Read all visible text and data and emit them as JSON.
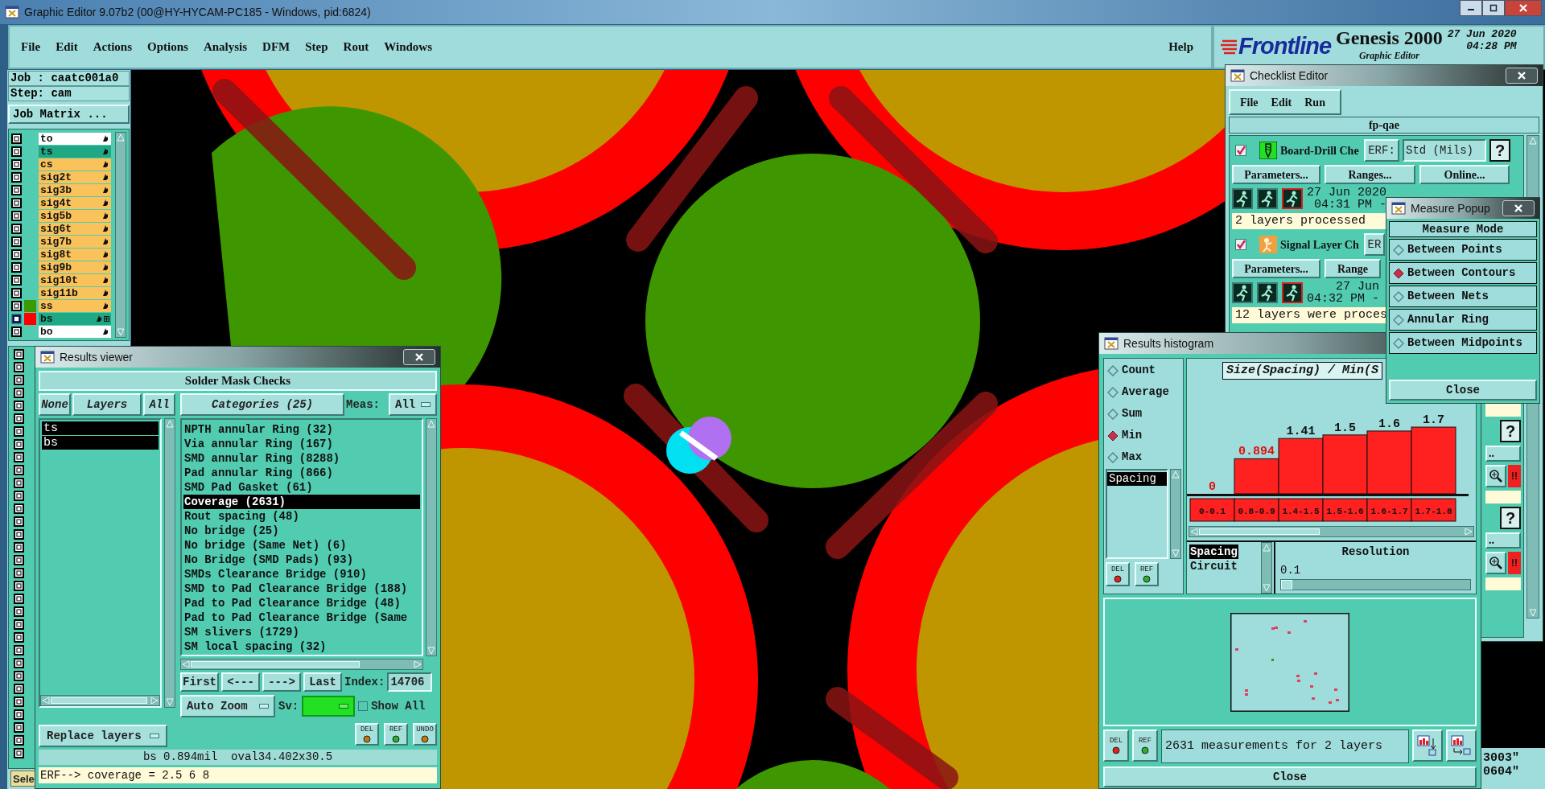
{
  "window": {
    "title": "Graphic Editor 9.07b2 (00@HY-HYCAM-PC185 - Windows, pid:6824)"
  },
  "menu": [
    "File",
    "Edit",
    "Actions",
    "Options",
    "Analysis",
    "DFM",
    "Step",
    "Rout",
    "Windows"
  ],
  "help": "Help",
  "branding": {
    "logo": "Frontline",
    "product": "Genesis 2000",
    "subtitle": "Graphic Editor",
    "date": "27 Jun 2020",
    "time": "04:28 PM"
  },
  "job": {
    "job": "Job : caatc001a0",
    "step": "Step: cam",
    "matrix_button": "Job Matrix ..."
  },
  "layers": [
    {
      "name": "to",
      "kind": "misc",
      "selected": false
    },
    {
      "name": "ts",
      "kind": "mask",
      "selected": false
    },
    {
      "name": "cs",
      "kind": "board",
      "selected": false
    },
    {
      "name": "sig2t",
      "kind": "board",
      "selected": false
    },
    {
      "name": "sig3b",
      "kind": "board",
      "selected": false
    },
    {
      "name": "sig4t",
      "kind": "board",
      "selected": false
    },
    {
      "name": "sig5b",
      "kind": "board",
      "selected": false
    },
    {
      "name": "sig6t",
      "kind": "board",
      "selected": false
    },
    {
      "name": "sig7b",
      "kind": "board",
      "selected": false
    },
    {
      "name": "sig8t",
      "kind": "board",
      "selected": false
    },
    {
      "name": "sig9b",
      "kind": "board",
      "selected": false
    },
    {
      "name": "sig10t",
      "kind": "board",
      "selected": false
    },
    {
      "name": "sig11b",
      "kind": "board",
      "selected": false
    },
    {
      "name": "ss",
      "kind": "board",
      "color": "#3a9a00",
      "selected": false
    },
    {
      "name": "bs",
      "kind": "mask",
      "color": "#ff0000",
      "selected": true
    },
    {
      "name": "bo",
      "kind": "misc",
      "selected": false
    }
  ],
  "more_layer_checkboxes": [
    {
      "checked": false
    },
    {
      "checked": false
    },
    {
      "checked": false
    },
    {
      "checked": false
    },
    {
      "checked": false
    },
    {
      "checked": false
    },
    {
      "checked": false
    },
    {
      "checked": false
    },
    {
      "checked": false
    },
    {
      "checked": false
    },
    {
      "checked": false
    },
    {
      "checked": false
    },
    {
      "checked": false
    },
    {
      "checked": false
    },
    {
      "checked": false
    },
    {
      "checked": false
    },
    {
      "checked": false
    },
    {
      "checked": false
    },
    {
      "checked": false
    },
    {
      "checked": false
    },
    {
      "checked": false
    },
    {
      "checked": false
    },
    {
      "checked": false
    },
    {
      "checked": false
    },
    {
      "checked": false
    },
    {
      "checked": false
    },
    {
      "checked": false
    },
    {
      "checked": false
    },
    {
      "checked": false
    },
    {
      "checked": false
    },
    {
      "checked": false
    },
    {
      "checked": false
    }
  ],
  "status_button": "Sele",
  "results_viewer": {
    "title": "Results viewer",
    "heading": "Solder Mask Checks",
    "layer_buttons": [
      "None",
      "Layers",
      "All"
    ],
    "layers": [
      {
        "name": "ts",
        "selected": true
      },
      {
        "name": "bs",
        "selected": true
      }
    ],
    "categories_button": "Categories (25)",
    "meas_label": "Meas:",
    "meas_value": "All",
    "categories": [
      {
        "label": "NPTH annular Ring (32)",
        "selected": false
      },
      {
        "label": "Via annular Ring (167)",
        "selected": false
      },
      {
        "label": "SMD annular Ring (8288)",
        "selected": false
      },
      {
        "label": "Pad annular Ring (866)",
        "selected": false
      },
      {
        "label": "SMD Pad Gasket (61)",
        "selected": false
      },
      {
        "label": "Coverage (2631)",
        "selected": true
      },
      {
        "label": "Rout spacing (48)",
        "selected": false
      },
      {
        "label": "No bridge (25)",
        "selected": false
      },
      {
        "label": "No bridge (Same Net) (6)",
        "selected": false
      },
      {
        "label": "No Bridge (SMD Pads) (93)",
        "selected": false
      },
      {
        "label": "SMDs Clearance Bridge (910)",
        "selected": false
      },
      {
        "label": "SMD to Pad Clearance Bridge (188)",
        "selected": false
      },
      {
        "label": "Pad to Pad Clearance Bridge (48)",
        "selected": false
      },
      {
        "label": "Pad to Pad Clearance Bridge (Same",
        "selected": false
      },
      {
        "label": "SM slivers (1729)",
        "selected": false
      },
      {
        "label": "SM local spacing (32)",
        "selected": false
      }
    ],
    "nav_buttons": [
      "First",
      "<---",
      "--->",
      "Last"
    ],
    "index_label": "Index:",
    "index_value": "14706",
    "zoom_mode": "Auto Zoom",
    "sv_label": "Sv:",
    "show_all": {
      "label": "Show All",
      "checked": false
    },
    "replace_mode": "Replace layers",
    "action_buttons": [
      "DEL",
      "REF",
      "UNDO"
    ],
    "status": "bs 0.894mil  oval34.402x30.5",
    "erf": "ERF--> coverage = 2.5 6 8"
  },
  "checklist_editor": {
    "title": "Checklist Editor",
    "menu": [
      "File",
      "Edit",
      "Run"
    ],
    "name": "fp-qae",
    "checks": [
      {
        "kind": "drill",
        "checked": true,
        "name": "Board-Drill Che",
        "erf_button": "ERF:",
        "erf_value": "Std (Mils)",
        "help": "?",
        "buttons": [
          "Parameters...",
          "Ranges...",
          "Online..."
        ],
        "date": "27 Jun 2020",
        "time": "04:31 PM -",
        "status": "2 layers processed"
      },
      {
        "kind": "signal",
        "checked": true,
        "name": "Signal Layer Ch",
        "erf_button": "ER",
        "buttons": [
          "Parameters...",
          "Range"
        ],
        "date": "27 Jun",
        "time": "04:32 PM -",
        "status": "12 layers were proces"
      }
    ],
    "partial_checks": [
      {
        "help": "?",
        "more": "..",
        "alert": "!!"
      },
      {
        "help": "?",
        "more": "..",
        "alert": "!!"
      }
    ]
  },
  "measure_popup": {
    "title": "Measure Popup",
    "heading": "Measure Mode",
    "modes": [
      {
        "label": "Between Points",
        "selected": false
      },
      {
        "label": "Between Contours",
        "selected": true
      },
      {
        "label": "Between Nets",
        "selected": false
      },
      {
        "label": "Annular Ring",
        "selected": false
      },
      {
        "label": "Between Midpoints",
        "selected": false
      }
    ],
    "close": "Close"
  },
  "histogram": {
    "title": "Results histogram",
    "functions": [
      {
        "label": "Count",
        "selected": false
      },
      {
        "label": "Average",
        "selected": false
      },
      {
        "label": "Sum",
        "selected": false
      },
      {
        "label": "Min",
        "selected": true
      },
      {
        "label": "Max",
        "selected": false
      }
    ],
    "attributes": [
      {
        "label": "Spacing",
        "selected": true
      }
    ],
    "buttons": [
      "DEL",
      "REF"
    ],
    "chart_data": {
      "type": "bar",
      "title": "Size(Spacing) / Min(S",
      "categories": [
        "0-0.1",
        "0.8-0.9",
        "1.4-1.5",
        "1.5-1.6",
        "1.6-1.7",
        "1.7-1.8"
      ],
      "series": [
        {
          "color": "#ff2020",
          "values": [
            0,
            0.894,
            1.41,
            1.5,
            1.6,
            1.7
          ]
        }
      ],
      "data_labels": true
    },
    "fields": [
      {
        "label": "Spacing",
        "selected": true
      },
      {
        "label": "Circuit",
        "selected": false
      }
    ],
    "resolution": {
      "label": "Resolution",
      "value": "0.1",
      "level": 0.06
    },
    "bottom_buttons": [
      "DEL",
      "REF"
    ],
    "summary": "2631 measurements for 2 layers",
    "close": "Close"
  },
  "coordinates": [
    "3003\"",
    "0604\""
  ]
}
